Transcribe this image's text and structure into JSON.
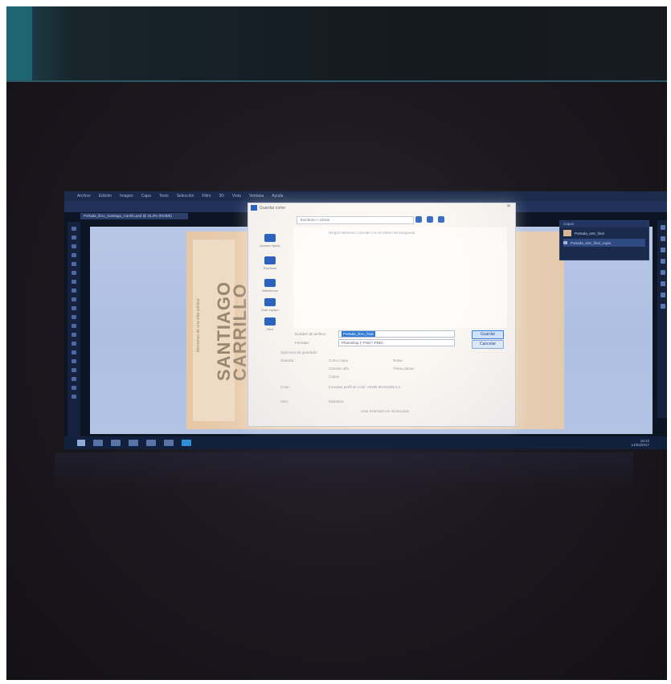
{
  "photo": {
    "desc": "Photo of a monitor showing Adobe Photoshop with a Save As dialog over a book cover design"
  },
  "photoshop": {
    "menu": [
      "Archivo",
      "Edición",
      "Imagen",
      "Capa",
      "Texto",
      "Selección",
      "Filtro",
      "3D",
      "Vista",
      "Ventana",
      "Ayuda"
    ],
    "doc_tab": "Portada_libro_Santiago_Carrillo.psd @ 33,3% (RGB/8)",
    "layers_panel": {
      "title": "Capas",
      "layers": [
        {
          "name": "Portada_arte_final"
        },
        {
          "name": "Portada_arte_final_copia"
        }
      ]
    },
    "book": {
      "title_line1": "SANTIAGO",
      "title_line2": "CARRILLO",
      "small_text": "Memorias de una vida política"
    },
    "taskbar": {
      "time": "18:42",
      "date": "14/03/2017"
    }
  },
  "save_dialog": {
    "title": "Guardar como",
    "path": "Escritorio > Libros",
    "hint": "Ningún elemento coincide con el criterio de búsqueda.",
    "sidebar": [
      {
        "label": "Acceso rápido"
      },
      {
        "label": "Escritorio"
      },
      {
        "label": "Bibliotecas"
      },
      {
        "label": "Este equipo"
      },
      {
        "label": "Red"
      }
    ],
    "filename_label": "Nombre de archivo:",
    "filename_value": "Portada_libro_final",
    "format_label": "Formato:",
    "format_value": "Photoshop (*.PSD;*.PDD)",
    "save_label": "Guardar",
    "cancel_label": "Cancelar",
    "options_header": "Opciones de guardado",
    "options": {
      "guardar": "Guardar:",
      "como_copia": "Como copia",
      "notas": "Notas",
      "canales_alfa": "Canales alfa",
      "tintas_planas": "Tintas planas",
      "capas": "Capas",
      "color": "Color:",
      "perfil": "Incrustar perfil de color: sRGB IEC61966-2.1",
      "otro": "Otro:",
      "miniatura": "Miniatura",
      "extension": "Usar extensión en minúsculas"
    }
  }
}
